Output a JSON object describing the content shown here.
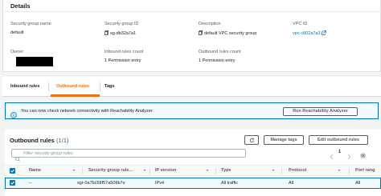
{
  "details": {
    "title": "Details",
    "fields": {
      "security_group_name": {
        "label": "Security group name",
        "value": "default"
      },
      "security_group_id": {
        "label": "Security group ID",
        "value": "sg-db32a7a1"
      },
      "description": {
        "label": "Description",
        "value": "default VPC security group"
      },
      "vpc_id": {
        "label": "VPC ID",
        "value": "vpc-c802a7a3"
      },
      "owner": {
        "label": "Owner",
        "value": ""
      },
      "inbound_rules_count": {
        "label": "Inbound rules count",
        "value": "1 Permission entry"
      },
      "outbound_rules_count": {
        "label": "Outbound rules count",
        "value": "1 Permission entry"
      }
    }
  },
  "tabs": [
    {
      "label": "Inbound rules",
      "active": false
    },
    {
      "label": "Outbound rules",
      "active": true
    },
    {
      "label": "Tags",
      "active": false
    }
  ],
  "banner": {
    "text": "You can now check network connectivity with Reachability Analyzer",
    "button": "Run Reachability Analyzer"
  },
  "outbound": {
    "title": "Outbound rules",
    "count": "(1/1)",
    "manage_tags": "Manage tags",
    "edit_rules": "Edit outbound rules",
    "search_placeholder": "Filter security group rules",
    "page": "1",
    "columns": [
      "Name",
      "Security group rule...",
      "IP version",
      "Type",
      "Protocol",
      "Port rang"
    ],
    "rows": [
      {
        "name": "–",
        "rule_id": "sgr-0a7bc58f57a509b7e",
        "ip_version": "IPv4",
        "type": "All traffic",
        "protocol": "All",
        "port_range": "All"
      }
    ]
  },
  "colors": {
    "accent": "#ec7211",
    "link": "#0073bb",
    "selected_bg": "#f1faff"
  }
}
